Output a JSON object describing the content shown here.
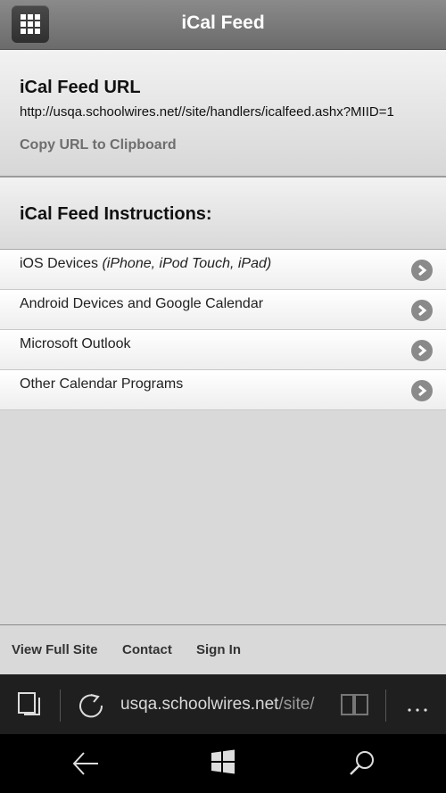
{
  "header": {
    "title": "iCal Feed"
  },
  "url_section": {
    "heading": "iCal Feed URL",
    "url": "http://usqa.schoolwires.net//site/handlers/icalfeed.ashx?MIID=1",
    "copy_label": "Copy URL to Clipboard"
  },
  "instructions": {
    "heading": "iCal Feed Instructions:",
    "items": [
      {
        "label": "iOS Devices ",
        "sub": "(iPhone, iPod Touch, iPad)"
      },
      {
        "label": "Android Devices and Google Calendar",
        "sub": ""
      },
      {
        "label": "Microsoft Outlook",
        "sub": ""
      },
      {
        "label": "Other Calendar Programs",
        "sub": ""
      }
    ]
  },
  "footer": {
    "view_full_site": "View Full Site",
    "contact": "Contact",
    "sign_in": "Sign In"
  },
  "browser": {
    "address_domain": "usqa.schoolwires.net",
    "address_path": "/site/"
  }
}
